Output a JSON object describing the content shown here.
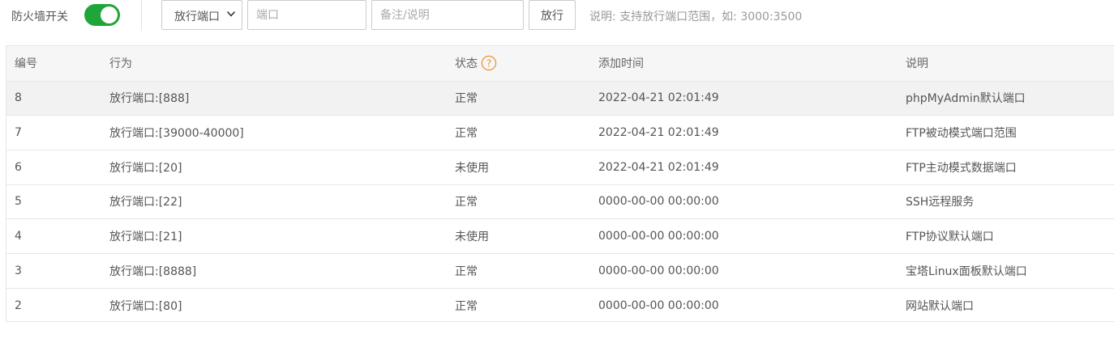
{
  "toolbar": {
    "firewall_label": "防火墙开关",
    "firewall_enabled": true,
    "action_select": "放行端口",
    "port_placeholder": "端口",
    "note_placeholder": "备注/说明",
    "allow_button": "放行",
    "hint": "说明: 支持放行端口范围，如: 3000:3500"
  },
  "colors": {
    "switch_on": "#20a53a",
    "help_icon": "#f0913c"
  },
  "table": {
    "headers": {
      "id": "编号",
      "action": "行为",
      "status": "状态",
      "added_time": "添加时间",
      "description": "说明"
    },
    "rows": [
      {
        "id": "8",
        "action": "放行端口:[888]",
        "status": "正常",
        "time": "2022-04-21 02:01:49",
        "desc": "phpMyAdmin默认端口"
      },
      {
        "id": "7",
        "action": "放行端口:[39000-40000]",
        "status": "正常",
        "time": "2022-04-21 02:01:49",
        "desc": "FTP被动模式端口范围"
      },
      {
        "id": "6",
        "action": "放行端口:[20]",
        "status": "未使用",
        "time": "2022-04-21 02:01:49",
        "desc": "FTP主动模式数据端口"
      },
      {
        "id": "5",
        "action": "放行端口:[22]",
        "status": "正常",
        "time": "0000-00-00 00:00:00",
        "desc": "SSH远程服务"
      },
      {
        "id": "4",
        "action": "放行端口:[21]",
        "status": "未使用",
        "time": "0000-00-00 00:00:00",
        "desc": "FTP协议默认端口"
      },
      {
        "id": "3",
        "action": "放行端口:[8888]",
        "status": "正常",
        "time": "0000-00-00 00:00:00",
        "desc": "宝塔Linux面板默认端口"
      },
      {
        "id": "2",
        "action": "放行端口:[80]",
        "status": "正常",
        "time": "0000-00-00 00:00:00",
        "desc": "网站默认端口"
      }
    ]
  }
}
